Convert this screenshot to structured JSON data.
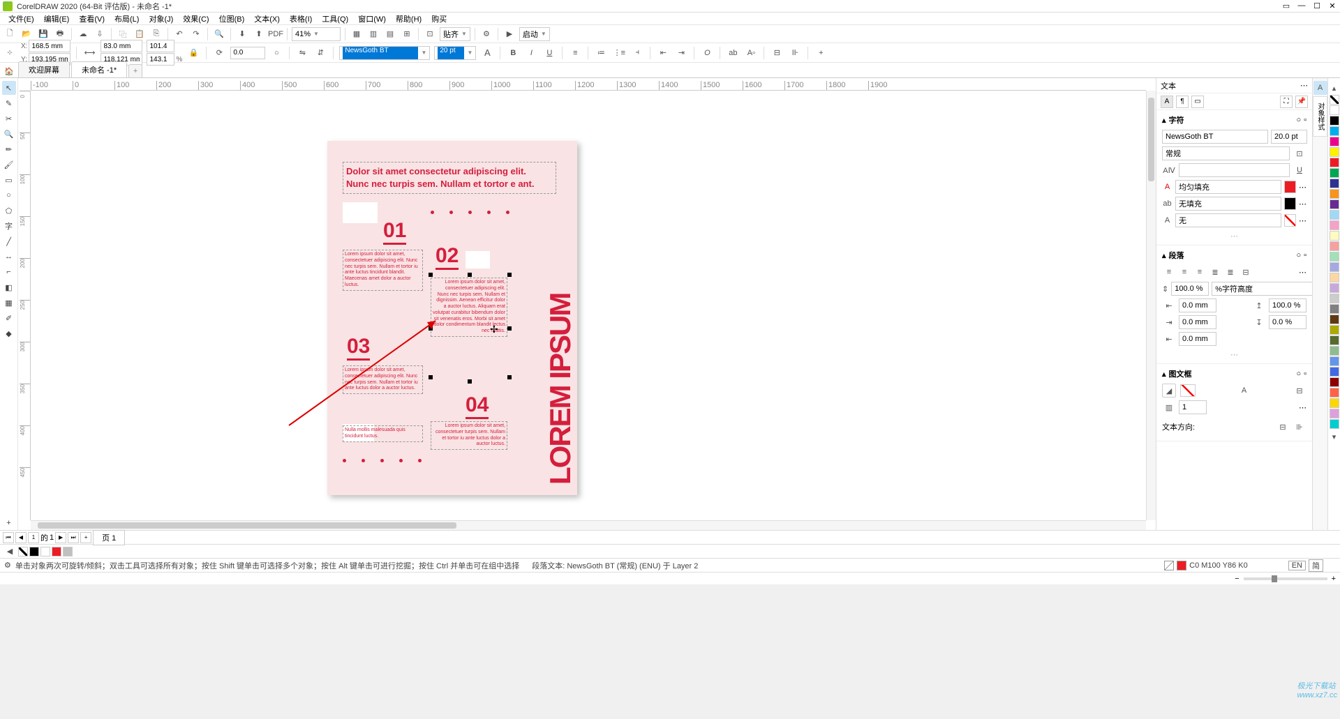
{
  "titlebar": {
    "app": "CorelDRAW 2020 (64-Bit 评估版) - 未命名 -1*"
  },
  "menu": [
    "文件(E)",
    "编辑(E)",
    "查看(V)",
    "布局(L)",
    "对象(J)",
    "效果(C)",
    "位图(B)",
    "文本(X)",
    "表格(I)",
    "工具(Q)",
    "窗口(W)",
    "帮助(H)",
    "购买"
  ],
  "toolbar1": {
    "zoom": "41%",
    "paste": "贴齐",
    "launch": "启动"
  },
  "propbar": {
    "x": "168.5 mm",
    "y": "193.195 mm",
    "w": "83.0 mm",
    "h": "118.121 mm",
    "sx": "101.4",
    "sy": "143.1",
    "unit": "%",
    "rot": "0.0",
    "font": "NewsGoth BT",
    "size": "20 pt"
  },
  "tabs": {
    "welcome": "欢迎屏幕",
    "doc": "未命名 -1*",
    "add": "+"
  },
  "hticks": [
    -100,
    0,
    100,
    200,
    300,
    400,
    500,
    600,
    700,
    800,
    900,
    1000,
    1100,
    1200,
    1300,
    1400,
    1500,
    1600,
    1700,
    1800,
    1900
  ],
  "vticks": [
    0,
    50,
    100,
    150,
    200,
    250,
    300,
    350,
    400,
    450
  ],
  "page": {
    "vert": "LOREM IPSUM",
    "hdr": "Dolor sit amet consectetur adipiscing elit.\nNunc nec turpis sem. Nullam et tortor e ant.",
    "n1": "01",
    "n2": "02",
    "n3": "03",
    "n4": "04",
    "t1": "Lorem ipsum dolor sit amet, consectetuer adipiscing elit. Nunc nec turpis sem. Nullam et tortor iu ante luctus tincidunt blandit. Maecenas amet dolor a auctor luctus.",
    "t2": "Lorem ipsum dolor sit amet, consectetuer adipiscing elit. Nunc nec turpis sem. Nullam et dignissim. Aenean efficitur dolor a auctor luctus.\n\nAliquam erat volutpat curabitur bibendum dolor sit venenatis eros. Morbi sit amet dolor condimentum blandit lectus nec mattis.",
    "t3": "Lorem ipsum dolor sit amet, consectetuer adipiscing elit. Nunc nec turpis sem. Nullam et tortor iu ante luctus dolor a auctor luctus.",
    "t4": "Nulla mollis malesuada quis tincidunt luctus.",
    "t5": "Lorem ipsum dolor sit amet, consectetuer turpis sem. Nullam et tortor iu ante luctus dolor a auctor luctus."
  },
  "docker": {
    "title": "文本",
    "char": "字符",
    "para": "段落",
    "frame": "图文框",
    "font": "NewsGoth BT",
    "size": "20.0 pt",
    "style": "常规",
    "fill": "均匀填充",
    "stroke": "无填充",
    "outline": "无",
    "line": "100.0 %",
    "lineMode": "%字符高度",
    "before": "0.0 mm",
    "after": "0.0 mm",
    "firstline": "0.0 mm",
    "left": "100.0 %",
    "right": "0.0 %",
    "cols": "1",
    "dirLbl": "文本方向:"
  },
  "vtabs": [
    "对象样式"
  ],
  "palette": [
    "#ffffff",
    "#000000",
    "#00aeef",
    "#ec008c",
    "#fff200",
    "#ed1c24",
    "#00a651",
    "#2e3192",
    "#f7941d",
    "#662d91",
    "#a0d9f7",
    "#f5a2c7",
    "#fffac2",
    "#f6a0a0",
    "#a2e0b8",
    "#a6a9e0",
    "#fcd7a6",
    "#c6a9db",
    "#cccccc",
    "#808080",
    "#603913",
    "#aaaa00",
    "#556b2f",
    "#8fbc8f",
    "#6495ed",
    "#4169e1",
    "#8b0000",
    "#ff6347",
    "#ffd700",
    "#dda0dd",
    "#00ced1"
  ],
  "pagenav": {
    "page": "页 1",
    "of": "1",
    "ofLbl": "的",
    "idx": "1"
  },
  "hpalette": [
    "#000000",
    "#ffffff",
    "#ed1c24",
    "#c0c0c0"
  ],
  "status": {
    "hint": "单击对象两次可旋转/倾斜；双击工具可选择所有对象；按住 Shift 键单击可选择多个对象；按住 Alt 键单击可进行挖掘；按住 Ctrl 并单击可在组中选择",
    "textinfo": "段落文本:    NewsGoth BT (常规) (ENU) 于 Layer 2",
    "fill": "C0 M100 Y86 K0",
    "lang": "EN",
    "ime": "简"
  },
  "watermark": "极光下载站\nwww.xz7.cc"
}
